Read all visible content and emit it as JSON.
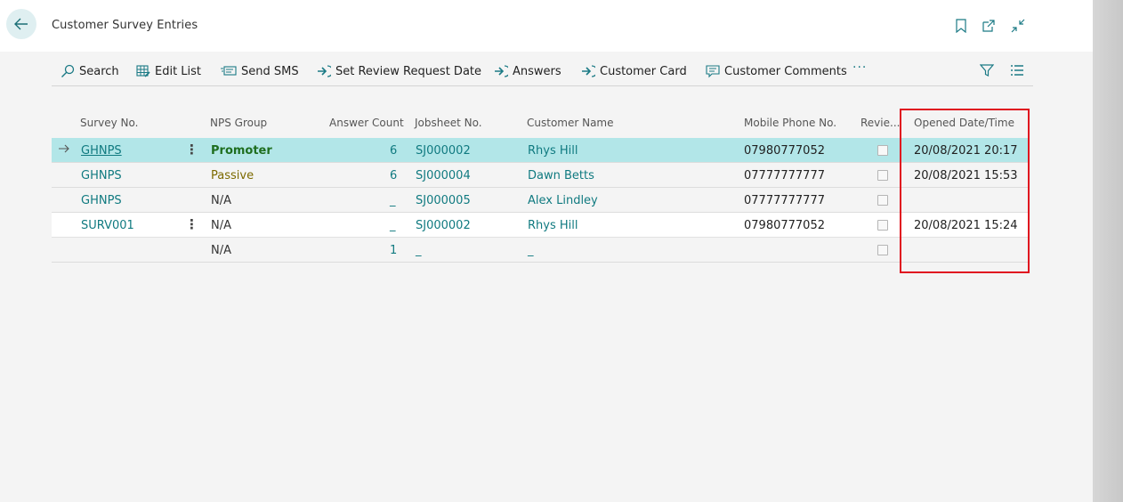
{
  "header": {
    "title": "Customer Survey Entries"
  },
  "actions": {
    "search": "Search",
    "edit_list": "Edit List",
    "send_sms": "Send SMS",
    "set_review": "Set Review Request Date",
    "answers": "Answers",
    "customer_card": "Customer Card",
    "customer_comments": "Customer Comments",
    "more": "···"
  },
  "table": {
    "columns": {
      "survey_no": "Survey No.",
      "nps_group": "NPS Group",
      "answer_count": "Answer Count",
      "jobsheet_no": "Jobsheet No.",
      "customer_name": "Customer Name",
      "mobile": "Mobile Phone No.",
      "review": "Revie...",
      "opened": "Opened Date/Time"
    },
    "rows": [
      {
        "survey_no": "GHNPS",
        "nps_group": "Promoter",
        "answer_count": "6",
        "jobsheet_no": "SJ000002",
        "customer_name": "Rhys Hill",
        "mobile": "07980777052",
        "opened": "20/08/2021 20:17"
      },
      {
        "survey_no": "GHNPS",
        "nps_group": "Passive",
        "answer_count": "6",
        "jobsheet_no": "SJ000004",
        "customer_name": "Dawn Betts",
        "mobile": "07777777777",
        "opened": "20/08/2021 15:53"
      },
      {
        "survey_no": "GHNPS",
        "nps_group": "N/A",
        "answer_count": "_",
        "jobsheet_no": "SJ000005",
        "customer_name": "Alex Lindley",
        "mobile": "07777777777",
        "opened": ""
      },
      {
        "survey_no": "SURV001",
        "nps_group": "N/A",
        "answer_count": "_",
        "jobsheet_no": "SJ000002",
        "customer_name": "Rhys Hill",
        "mobile": "07980777052",
        "opened": "20/08/2021 15:24"
      },
      {
        "survey_no": "",
        "nps_group": "N/A",
        "answer_count": "1",
        "jobsheet_no": "_",
        "customer_name": "_",
        "mobile": "",
        "opened": ""
      }
    ]
  },
  "colors": {
    "accent": "#107a80",
    "selected_row": "#b2e6e8",
    "highlight": "#e0121f",
    "promoter": "#1f6e1f",
    "passive": "#7c6a00"
  }
}
